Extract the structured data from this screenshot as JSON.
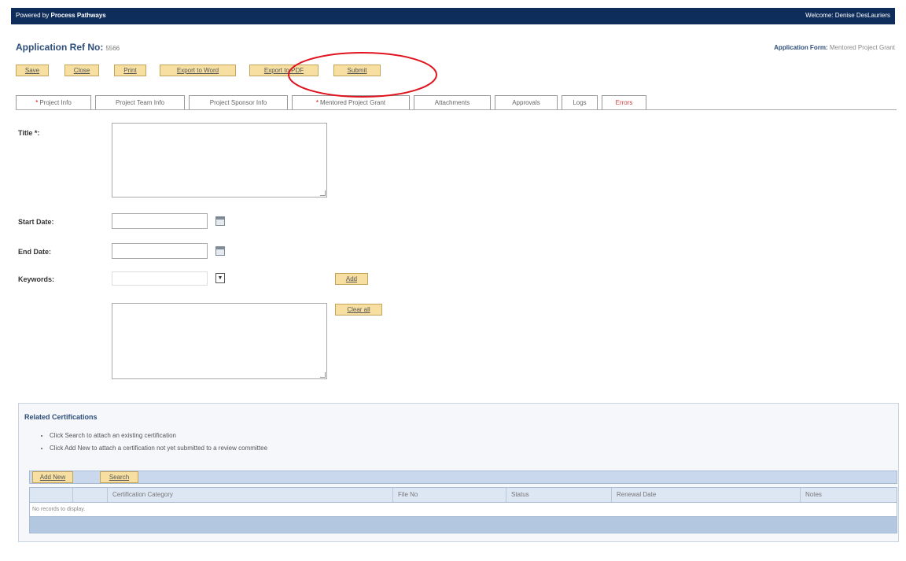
{
  "header": {
    "powered_by_prefix": "Powered by",
    "powered_by_brand": "Process Pathways",
    "welcome": "Welcome: Denise DesLauriers"
  },
  "application": {
    "ref_label": "Application Ref No:",
    "ref_number": "5566",
    "form_label": "Application Form:",
    "form_name": "Mentored Project Grant"
  },
  "toolbar": {
    "save": "Save",
    "close": "Close",
    "print": "Print",
    "export_word": "Export to Word",
    "export_pdf": "Export to PDF",
    "submit": "Submit"
  },
  "tabs": [
    {
      "label": "Project Info",
      "required": "*"
    },
    {
      "label": "Project Team Info"
    },
    {
      "label": "Project Sponsor Info"
    },
    {
      "label": "Mentored Project Grant",
      "required": "*"
    },
    {
      "label": "Attachments"
    },
    {
      "label": "Approvals"
    },
    {
      "label": "Logs"
    },
    {
      "label": "Errors"
    }
  ],
  "form": {
    "title_label": "Title *:",
    "title_value": "",
    "start_date_label": "Start Date:",
    "start_date_value": "",
    "end_date_label": "End Date:",
    "end_date_value": "",
    "keywords_label": "Keywords:",
    "keywords_value": "",
    "add_button": "Add",
    "clear_all_button": "Clear all",
    "keywords_list_value": ""
  },
  "certifications": {
    "title": "Related Certifications",
    "instructions": [
      "Click Search to attach an existing certification",
      "Click Add New to attach a certification not yet submitted to a review committee"
    ],
    "add_new_button": "Add New",
    "search_button": "Search",
    "columns": [
      "Certification Category",
      "File No",
      "Status",
      "Renewal Date",
      "Notes"
    ],
    "empty_message": "No records to display."
  },
  "colors": {
    "header_bg": "#0f2d5a",
    "button_bg": "#f6dfa0",
    "annotation": "#e0141e",
    "grid_header": "#c9d8ec",
    "grid_footer": "#b4c7e0"
  }
}
